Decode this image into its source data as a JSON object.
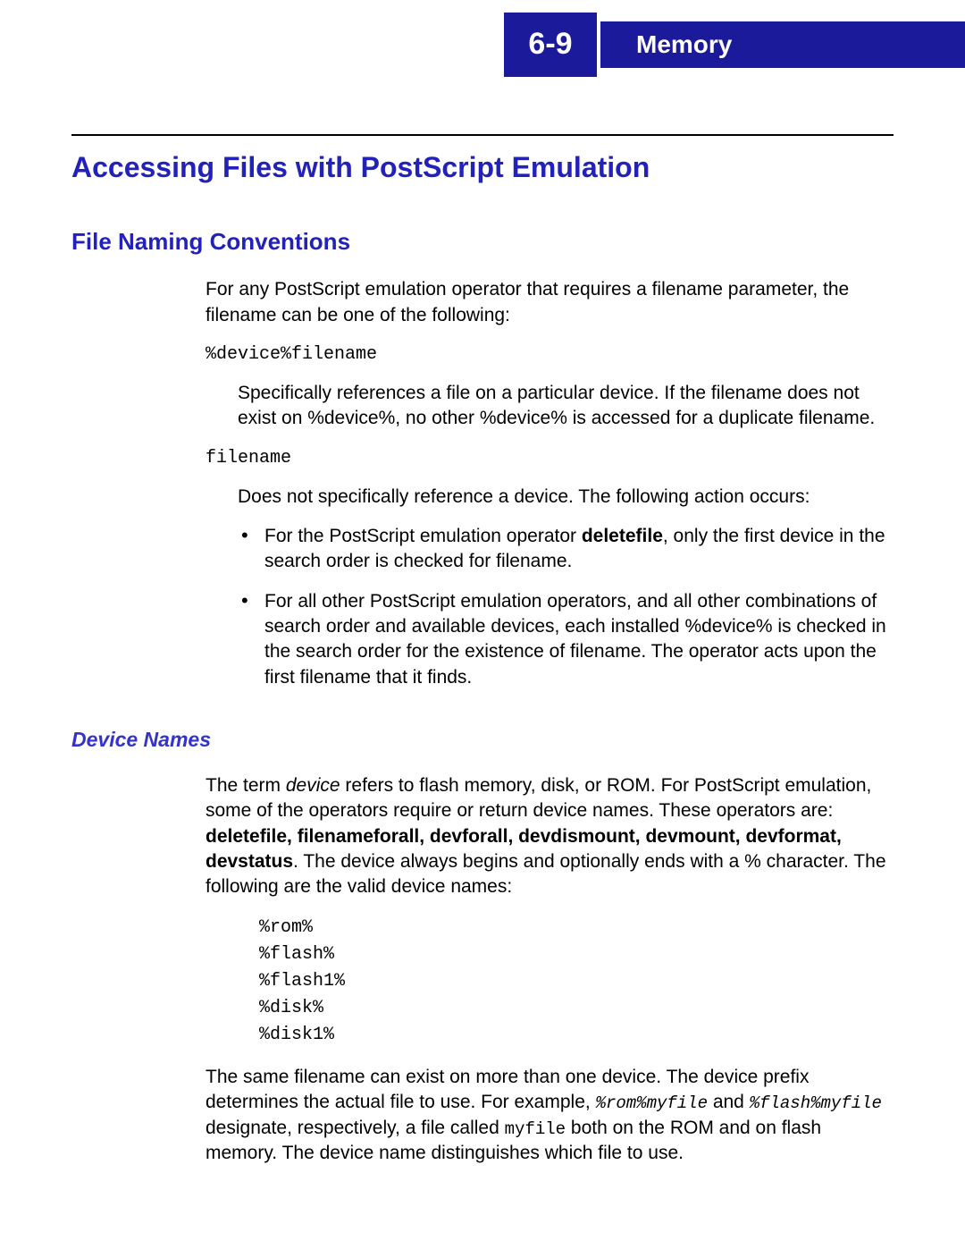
{
  "header": {
    "page_number": "6-9",
    "chapter_title": "Memory"
  },
  "section": {
    "title": "Accessing Files with PostScript Emulation"
  },
  "file_naming": {
    "heading": "File Naming Conventions",
    "intro": "For any PostScript emulation operator that requires a filename parameter, the filename can be one of the following:",
    "opt1_code": "%device%filename",
    "opt1_desc": "Specifically references a file on a particular device. If the filename does not exist on %device%, no other %device% is accessed for a duplicate filename.",
    "opt2_code": "filename",
    "opt2_desc": "Does not specifically reference a device. The following action occurs:",
    "bullet1_pre": "For the PostScript emulation operator ",
    "bullet1_bold": "deletefile",
    "bullet1_post": ", only the first device in the search order is checked for filename.",
    "bullet2": "For all other PostScript emulation operators, and all other combinations of search order and available devices, each installed %device% is checked in the search order for the existence of filename. The operator acts upon the first filename that it finds."
  },
  "device_names": {
    "heading": "Device Names",
    "p1_a": "The term ",
    "p1_italic": "device",
    "p1_b": " refers to flash memory, disk, or ROM. For PostScript emulation, some of the operators require or return device names. These operators are: ",
    "p1_bold": "deletefile, filenameforall, devforall, devdismount, devmount, devformat, devstatus",
    "p1_c": ". The device always begins and optionally ends with a % character. The following are the valid device names:",
    "devices": [
      "%rom%",
      "%flash%",
      "%flash1%",
      "%disk%",
      "%disk1%"
    ],
    "p2_a": "The same filename can exist on more than one device. The device prefix determines the actual file to use. For example, ",
    "p2_code1": "%rom%myfile",
    "p2_b": " and ",
    "p2_code2": "%flash%myfile",
    "p2_c": " designate, respectively, a file called ",
    "p2_code3": "myfile",
    "p2_d": " both on the ROM and on flash memory. The device name distinguishes which file to use."
  }
}
